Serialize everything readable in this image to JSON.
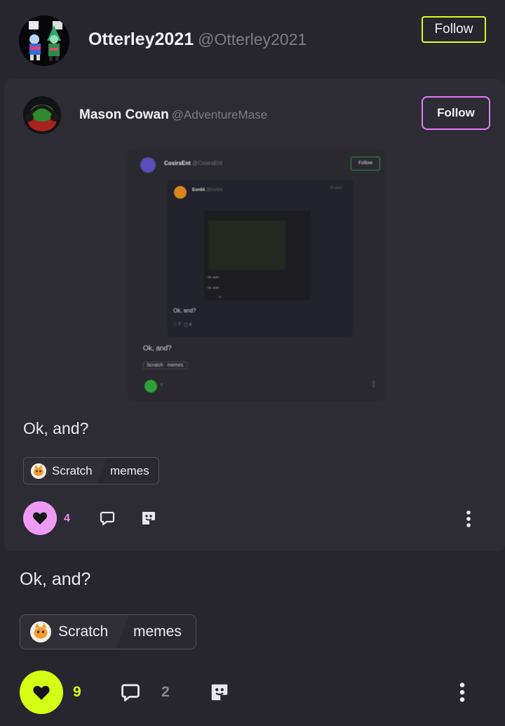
{
  "outer_post": {
    "author_name": "Otterley2021",
    "author_handle": "@Otterley2021",
    "follow_label": "Follow",
    "text": "Ok, and?",
    "tags": {
      "primary": "Scratch",
      "secondary": "memes"
    },
    "likes": "9",
    "comments": "2",
    "accent_color": "#d5ff14"
  },
  "quoted_post": {
    "author_name": "Mason Cowan",
    "author_handle": "@AdventureMase",
    "follow_label": "Follow",
    "text": "Ok, and?",
    "tags": {
      "primary": "Scratch",
      "secondary": "memes"
    },
    "likes": "4",
    "accent_color": "#ee9bf5"
  },
  "embedded_screenshot": {
    "author_name": "CosirsEnt",
    "author_handle": "@CosirsEnt",
    "follow_label": "Follow",
    "text": "Ok, and?",
    "tag_primary": "Scratch",
    "tag_secondary": "memes",
    "likes": "6",
    "nested": {
      "author_name": "Eon64",
      "author_handle": "@Eon64",
      "time": "15 days",
      "text": "Ok, and?",
      "likes": "7",
      "comments": "4",
      "deeper": {
        "text_1": "Ok, and?",
        "text_2": "Ok, and?",
        "count": "15"
      }
    }
  }
}
